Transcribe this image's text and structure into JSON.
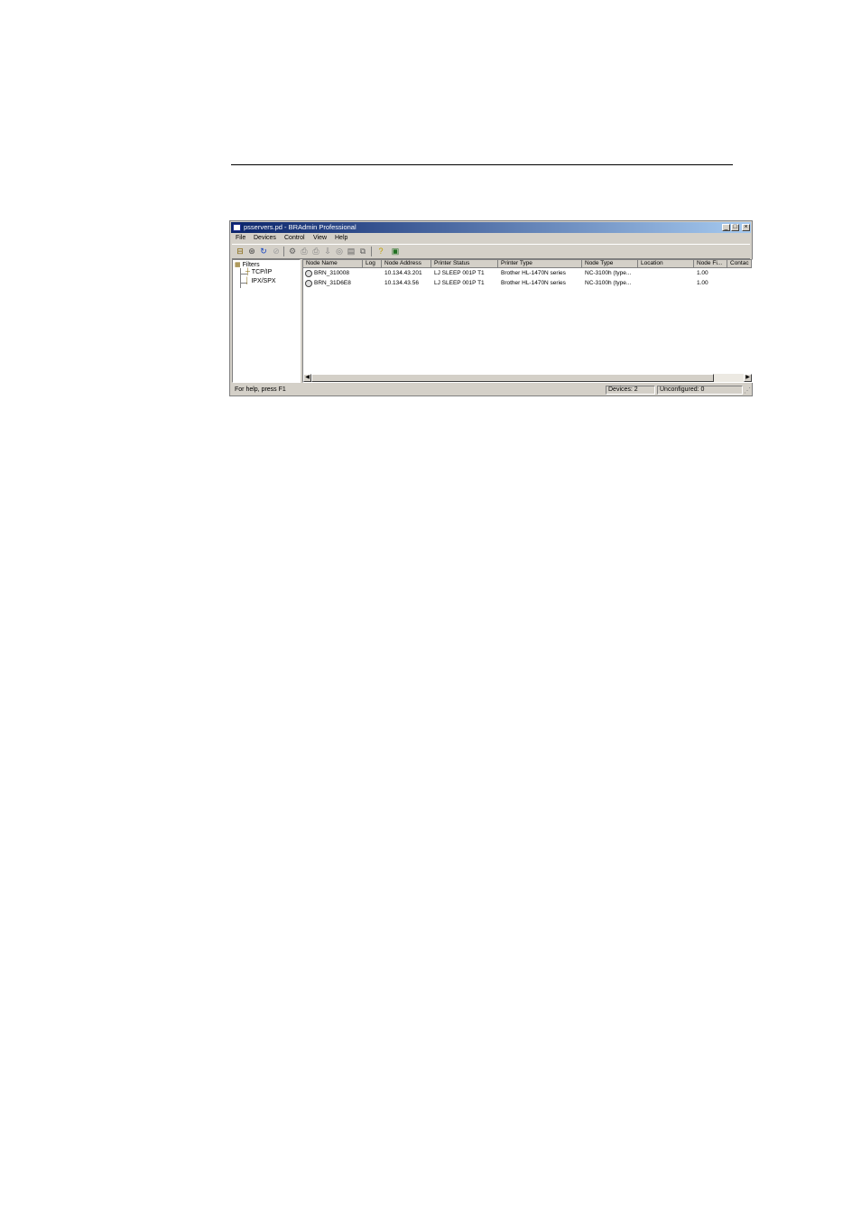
{
  "window": {
    "title": "psservers.pd - BRAdmin Professional",
    "controls": {
      "minimize": "_",
      "maximize": "□",
      "close": "×"
    }
  },
  "menu": [
    "File",
    "Devices",
    "Control",
    "View",
    "Help"
  ],
  "toolbar_icons": [
    "open-icon",
    "search-icon",
    "refresh-icon",
    "stop-icon",
    "configure-icon",
    "printer-icon",
    "printer-settings-icon",
    "load-firmware-icon",
    "web-icon",
    "properties-icon",
    "copy-icon",
    "help-icon",
    "exit-icon"
  ],
  "tree": {
    "root": "Filters",
    "children": [
      "TCP/IP",
      "IPX/SPX"
    ]
  },
  "columns": [
    "Node Name",
    "Log",
    "Node Address",
    "Printer Status",
    "Printer Type",
    "Node Type",
    "Location",
    "Node Fi...",
    "Contac"
  ],
  "rows": [
    {
      "node_name": "BRN_310008",
      "log": "",
      "node_address": "10.134.43.201",
      "printer_status": "LJ SLEEP 001P T1",
      "printer_type": "Brother HL-1470N series",
      "node_type": "NC-3100h (type...",
      "location": "",
      "node_fw": "1.00",
      "contact": ""
    },
    {
      "node_name": "BRN_31D6E8",
      "log": "",
      "node_address": "10.134.43.56",
      "printer_status": "LJ SLEEP 001P T1",
      "printer_type": "Brother HL-1470N series",
      "node_type": "NC-3100h (type...",
      "location": "",
      "node_fw": "1.00",
      "contact": ""
    }
  ],
  "status": {
    "help": "For help, press F1",
    "devices": "Devices: 2",
    "unconfigured": "Unconfigured: 0"
  }
}
